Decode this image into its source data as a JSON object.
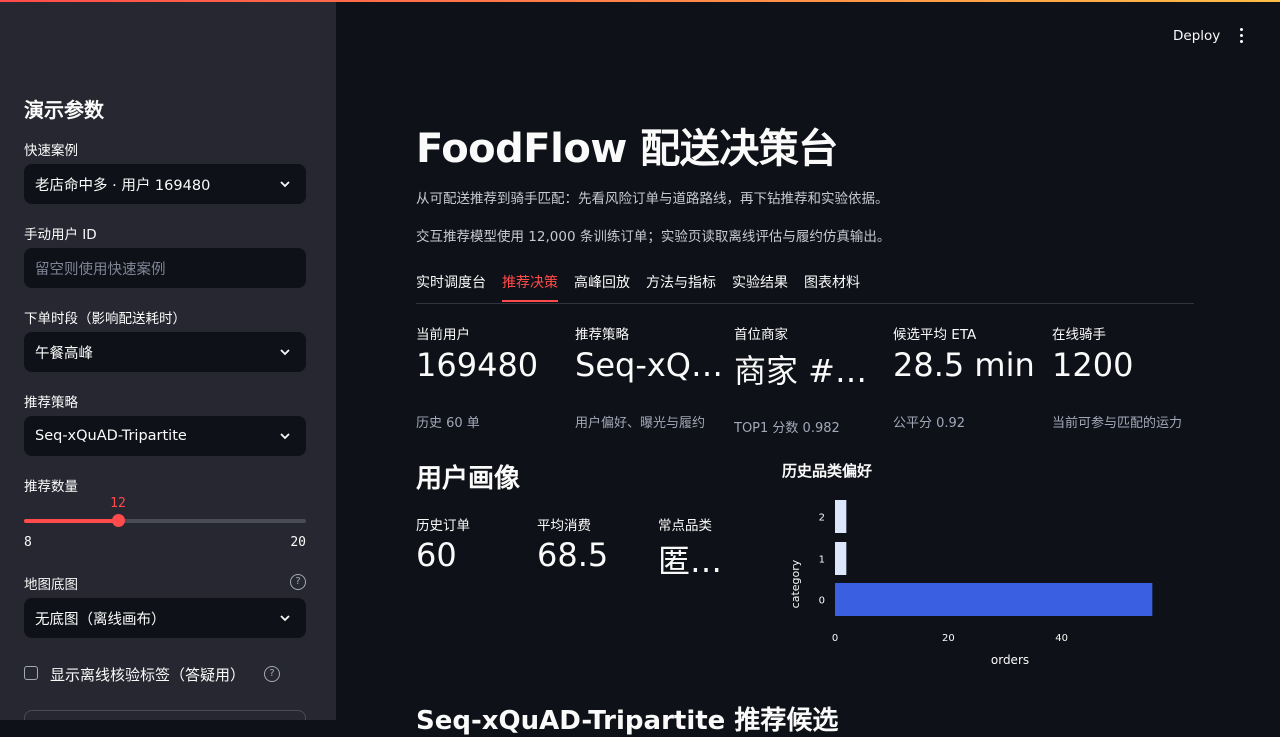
{
  "sidebar": {
    "title": "演示参数",
    "quick_case": {
      "label": "快速案例",
      "value": "老店命中多 · 用户 169480"
    },
    "manual_user": {
      "label": "手动用户 ID",
      "placeholder": "留空则使用快速案例"
    },
    "order_time": {
      "label": "下单时段（影响配送耗时）",
      "value": "午餐高峰"
    },
    "strategy": {
      "label": "推荐策略",
      "value": "Seq-xQuAD-Tripartite"
    },
    "rec_count": {
      "label": "推荐数量",
      "value": "12",
      "min": "8",
      "max": "20",
      "fraction": 0.3333
    },
    "basemap": {
      "label": "地图底图",
      "value": "无底图（离线画布）",
      "help": "?"
    },
    "debug_checkbox": {
      "label": "显示离线核验标签（答疑用）",
      "checked": false,
      "help": "?"
    }
  },
  "header": {
    "deploy_label": "Deploy"
  },
  "main": {
    "title": "FoodFlow 配送决策台",
    "caption1": "从可配送推荐到骑手匹配：先看风险订单与道路路线，再下钻推荐和实验依据。",
    "caption2": "交互推荐模型使用 12,000 条训练订单；实验页读取离线评估与履约仿真输出。",
    "tabs": [
      "实时调度台",
      "推荐决策",
      "高峰回放",
      "方法与指标",
      "实验结果",
      "图表材料"
    ],
    "active_tab": 1,
    "metrics": [
      {
        "label": "当前用户",
        "value": "169480",
        "delta": "历史 60 单"
      },
      {
        "label": "推荐策略",
        "value": "Seq-xQ…",
        "delta": "用户偏好、曝光与履约"
      },
      {
        "label": "首位商家",
        "value": "商家 #…",
        "delta": "TOP1 分数 0.982"
      },
      {
        "label": "候选平均 ETA",
        "value": "28.5 min",
        "delta": "公平分 0.92"
      },
      {
        "label": "在线骑手",
        "value": "1200",
        "delta": "当前可参与匹配的运力"
      }
    ],
    "profile": {
      "title": "用户画像",
      "metrics": [
        {
          "label": "历史订单",
          "value": "60"
        },
        {
          "label": "平均消费",
          "value": "68.5"
        },
        {
          "label": "常点品类",
          "value": "匿…"
        }
      ]
    },
    "next_section_title": "Seq-xQuAD-Tripartite 推荐候选"
  },
  "chart_data": {
    "type": "bar",
    "orientation": "horizontal",
    "title": "历史品类偏好",
    "xlabel": "orders",
    "ylabel": "category",
    "categories": [
      "2",
      "1",
      "0"
    ],
    "values": [
      2,
      2,
      56
    ],
    "colors": [
      "#dce7fb",
      "#dce7fb",
      "#3a5fe0"
    ],
    "xlim": [
      0,
      60
    ],
    "xticks": [
      0,
      20,
      40
    ]
  }
}
